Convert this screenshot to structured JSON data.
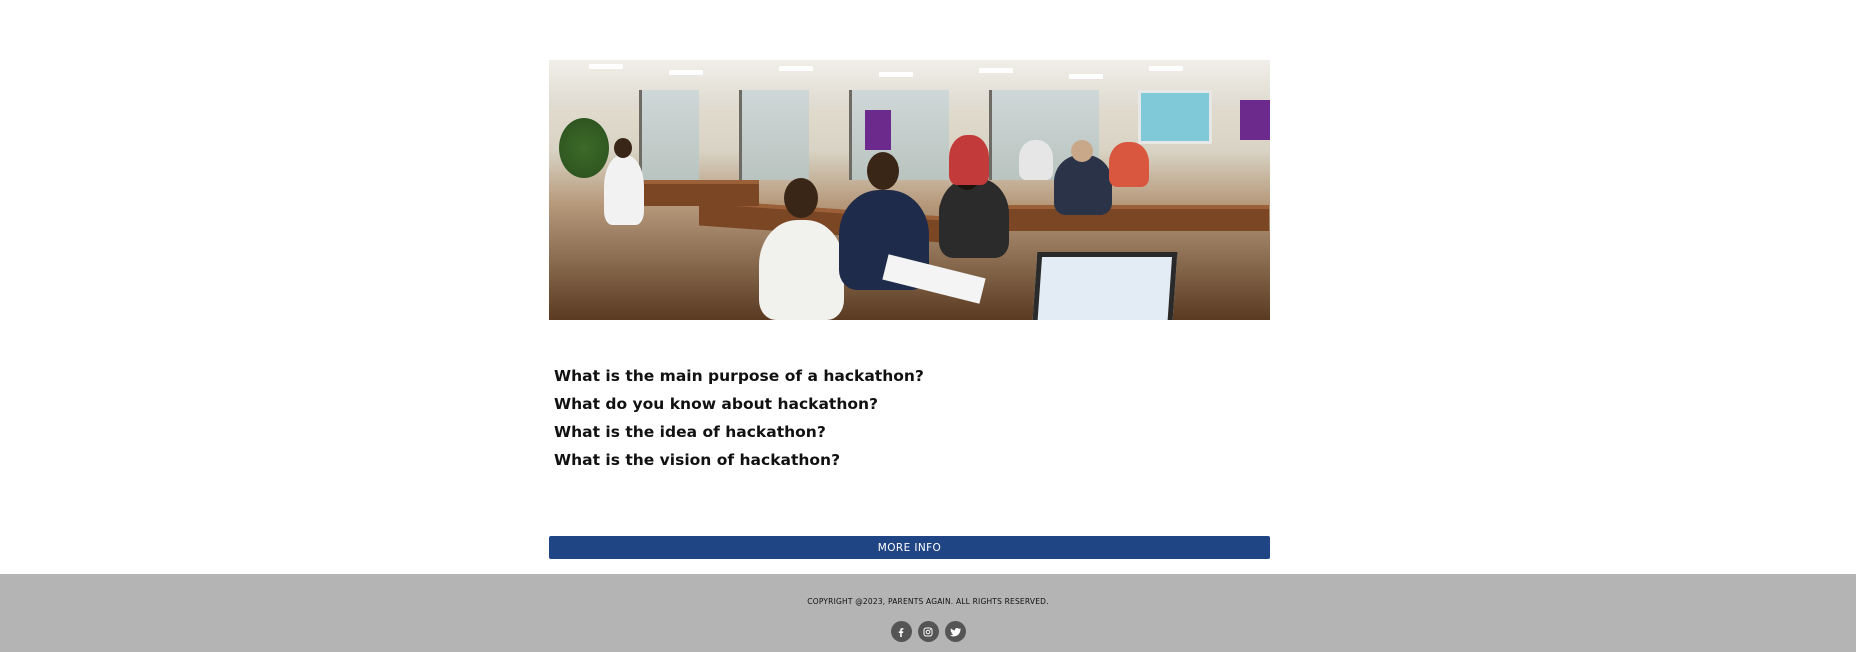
{
  "hero": {
    "alt": "People working at tables during a hackathon",
    "image_name": "hackathon-photo"
  },
  "questions": [
    "What is the main purpose of a hackathon?",
    "What do you know about hackathon?",
    "What is the idea of hackathon?",
    "What is the vision of hackathon?"
  ],
  "more_info_label": "MORE INFO",
  "footer": {
    "copyright": "COPYRIGHT @2023, PARENTS AGAIN. ALL RIGHTS RESERVED.",
    "socials": [
      {
        "icon": "facebook-icon"
      },
      {
        "icon": "instagram-icon"
      },
      {
        "icon": "twitter-icon"
      }
    ]
  },
  "colors": {
    "button": "#1f4585",
    "footer": "#b4b4b4",
    "social_bg": "#555555"
  }
}
